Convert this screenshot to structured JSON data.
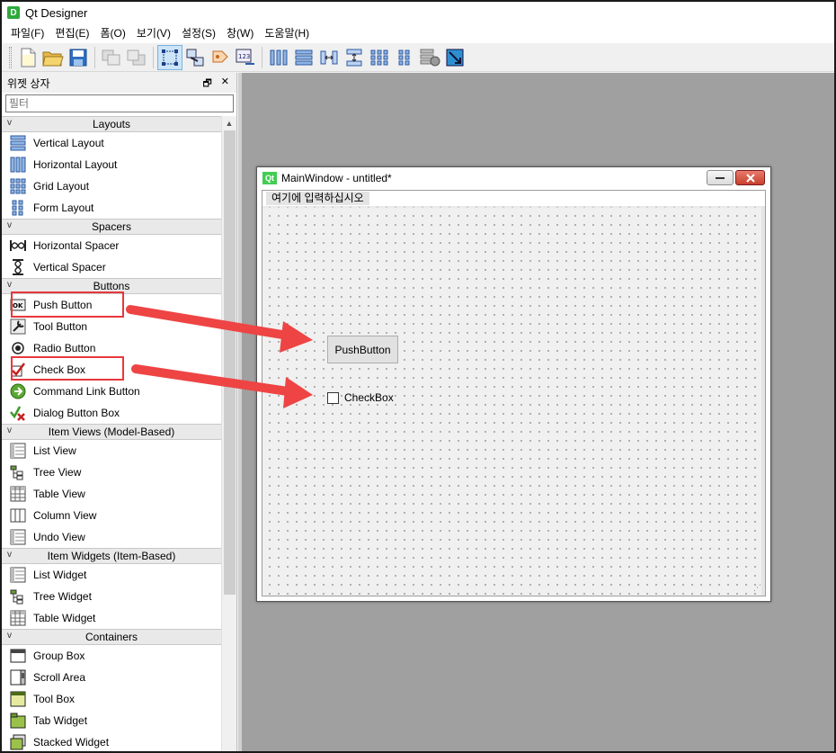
{
  "app": {
    "title": "Qt Designer",
    "icon_letter": "D"
  },
  "menubar": {
    "items": [
      "파일(F)",
      "편집(E)",
      "폼(O)",
      "보기(V)",
      "설정(S)",
      "창(W)",
      "도움말(H)"
    ]
  },
  "toolbar": {
    "icons": [
      "new-file-icon",
      "open-folder-icon",
      "save-icon",
      "send-to-back-icon",
      "bring-to-front-icon",
      "edit-widgets-icon",
      "edit-signals-slots-icon",
      "edit-buddies-icon",
      "edit-tab-order-icon",
      "layout-horizontal-icon",
      "layout-vertical-icon",
      "layout-horizontal-splitter-icon",
      "layout-vertical-splitter-icon",
      "layout-grid-icon",
      "layout-form-icon",
      "break-layout-icon",
      "adjust-size-icon"
    ]
  },
  "widget_box": {
    "title": "위젯 상자",
    "filter_placeholder": "필터",
    "categories": [
      {
        "name": "Layouts",
        "items": [
          "Vertical Layout",
          "Horizontal Layout",
          "Grid Layout",
          "Form Layout"
        ]
      },
      {
        "name": "Spacers",
        "items": [
          "Horizontal Spacer",
          "Vertical Spacer"
        ]
      },
      {
        "name": "Buttons",
        "items": [
          "Push Button",
          "Tool Button",
          "Radio Button",
          "Check Box",
          "Command Link Button",
          "Dialog Button Box"
        ]
      },
      {
        "name": "Item Views (Model-Based)",
        "items": [
          "List View",
          "Tree View",
          "Table View",
          "Column View",
          "Undo View"
        ]
      },
      {
        "name": "Item Widgets (Item-Based)",
        "items": [
          "List Widget",
          "Tree Widget",
          "Table Widget"
        ]
      },
      {
        "name": "Containers",
        "items": [
          "Group Box",
          "Scroll Area",
          "Tool Box",
          "Tab Widget",
          "Stacked Widget"
        ]
      }
    ]
  },
  "form": {
    "title": "MainWindow - untitled*",
    "qt_logo": "Qt",
    "menubar_placeholder": "여기에 입력하십시오",
    "push_button_text": "PushButton",
    "checkbox_text": "CheckBox"
  },
  "colors": {
    "highlight": "#e8383d",
    "arrow": "#ee4444",
    "workspace": "#a0a0a0"
  }
}
